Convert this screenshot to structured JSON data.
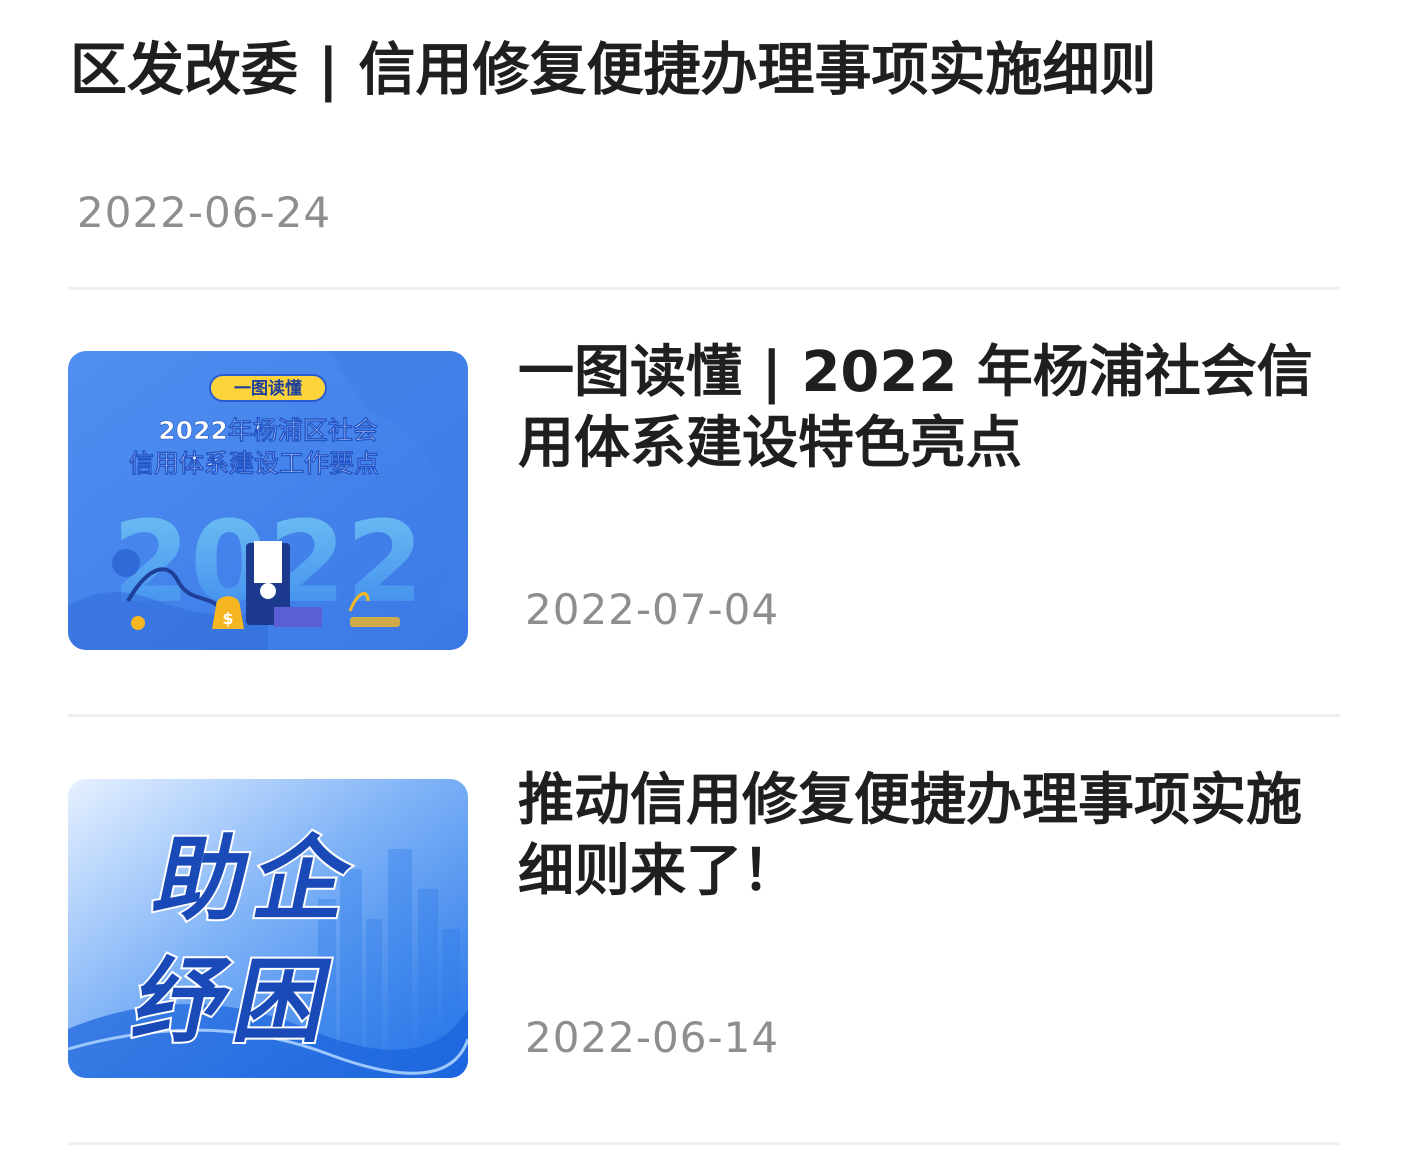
{
  "articles": [
    {
      "title": "区发改委 | 信用修复便捷办理事项实施细则",
      "date": "2022-06-24"
    },
    {
      "title": "一图读懂 | 2022 年杨浦社会信用体系建设特色亮点",
      "date": "2022-07-04",
      "thumbnail": {
        "badge": "一图读懂",
        "line1": "2022年杨浦区社会",
        "line2": "信用体系建设工作要点",
        "year": "2022"
      }
    },
    {
      "title": "推动信用修复便捷办理事项实施细则来了！",
      "date": "2022-06-14",
      "thumbnail": {
        "line1": "助企",
        "line2": "纾困"
      }
    }
  ]
}
